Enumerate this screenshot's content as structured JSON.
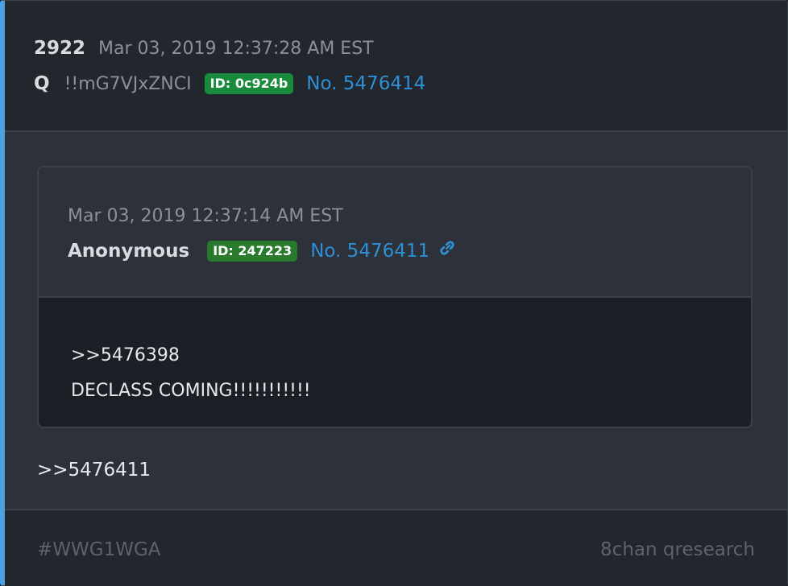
{
  "post": {
    "count": "2922",
    "timestamp": "Mar 03, 2019 12:37:28 AM EST",
    "author": "Q",
    "tripcode": "!!mG7VJxZNCI",
    "id_badge": "ID: 0c924b",
    "post_number": "No. 5476414",
    "reply_text": ">>5476411"
  },
  "quoted": {
    "timestamp": "Mar 03, 2019 12:37:14 AM EST",
    "author": "Anonymous",
    "id_badge": "ID: 247223",
    "post_number": "No. 5476411",
    "link_icon": "link-icon",
    "lines": [
      ">>5476398",
      "DECLASS COMING!!!!!!!!!!!"
    ]
  },
  "footer": {
    "hashtag": "#WWG1WGA",
    "source": "8chan qresearch"
  },
  "colors": {
    "accent": "#4aa3df",
    "link": "#2e8fd4",
    "badge_q": "#1a8a3c",
    "badge_anon": "#2a7a2e"
  }
}
